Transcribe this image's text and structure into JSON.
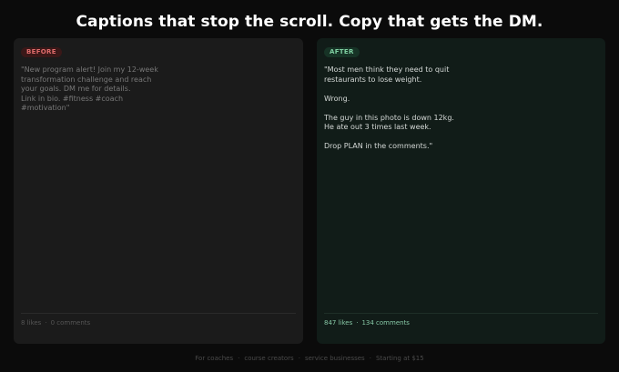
{
  "headline": "Captions that stop the scroll. Copy that gets the DM.",
  "colors": {
    "page_background": "#0b0b0b",
    "before_card": "#1b1b1b",
    "after_card": "#111c18",
    "before_accent": "#e06b6b",
    "after_accent": "#7fd0a2"
  },
  "before": {
    "badge": "BEFORE",
    "caption": "\"New program alert! Join my 12-week\ntransformation challenge and reach\nyour goals. DM me for details.\nLink in bio. #fitness #coach\n#motivation\"",
    "likes": "8 likes",
    "separator": "·",
    "comments": "0 comments"
  },
  "after": {
    "badge": "AFTER",
    "caption": "\"Most men think they need to quit\nrestaurants to lose weight.\n\nWrong.\n\nThe guy in this photo is down 12kg.\nHe ate out 3 times last week.\n\nDrop PLAN in the comments.\"",
    "likes": "847 likes",
    "separator": "·",
    "comments": "134 comments"
  },
  "footer": {
    "items": [
      "For coaches",
      "course creators",
      "service businesses",
      "Starting at $15"
    ],
    "separator": "·"
  }
}
